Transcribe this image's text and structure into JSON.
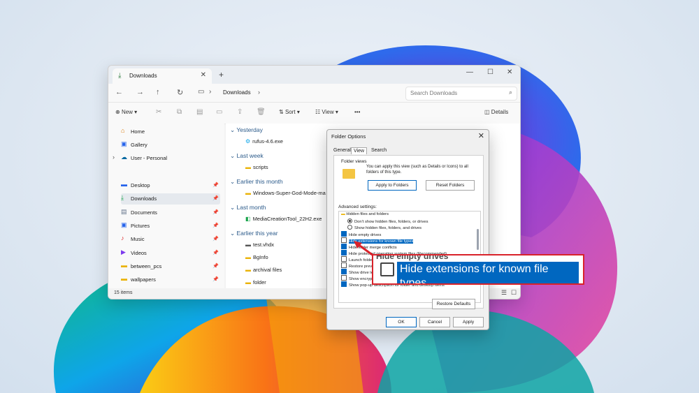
{
  "explorer": {
    "tab_title": "Downloads",
    "breadcrumb": "Downloads",
    "search_placeholder": "Search Downloads",
    "toolbar": {
      "new": "New",
      "sort": "Sort",
      "view": "View",
      "more": "•••",
      "details": "Details"
    },
    "sidebar": [
      {
        "label": "Home",
        "icon": "home-icon",
        "pinned": false
      },
      {
        "label": "Gallery",
        "icon": "gallery-icon",
        "pinned": false
      },
      {
        "label": "User - Personal",
        "icon": "cloud-icon",
        "pinned": false
      },
      {
        "label": "Desktop",
        "icon": "desktop-icon",
        "pinned": true
      },
      {
        "label": "Downloads",
        "icon": "download-icon",
        "pinned": true,
        "selected": true
      },
      {
        "label": "Documents",
        "icon": "documents-icon",
        "pinned": true
      },
      {
        "label": "Pictures",
        "icon": "pictures-icon",
        "pinned": true
      },
      {
        "label": "Music",
        "icon": "music-icon",
        "pinned": true
      },
      {
        "label": "Videos",
        "icon": "videos-icon",
        "pinned": true
      },
      {
        "label": "between_pcs",
        "icon": "folder-icon",
        "pinned": true
      },
      {
        "label": "wallpapers",
        "icon": "folder-icon",
        "pinned": true
      }
    ],
    "groups": [
      {
        "label": "Yesterday",
        "files": [
          "rufus-4.6.exe"
        ]
      },
      {
        "label": "Last week",
        "files": [
          "scripts"
        ]
      },
      {
        "label": "Earlier this month",
        "files": [
          "Windows-Super-God-Mode-ma"
        ]
      },
      {
        "label": "Last month",
        "files": [
          "MediaCreationTool_22H2.exe"
        ]
      },
      {
        "label": "Earlier this year",
        "files": [
          "test.vhdx",
          "BgInfo",
          "archival files",
          "folder"
        ]
      }
    ],
    "status": "15 items"
  },
  "dialog": {
    "title": "Folder Options",
    "tabs": [
      "General",
      "View",
      "Search"
    ],
    "folder_views_head": "Folder views",
    "folder_views_text": "You can apply this view (such as Details or Icons) to all folders of this type.",
    "apply_to_folders": "Apply to Folders",
    "reset_folders": "Reset Folders",
    "advanced_head": "Advanced settings:",
    "options": [
      {
        "type": "folder",
        "label": "Hidden files and folders"
      },
      {
        "type": "radio",
        "label": "Don't show hidden files, folders, or drives",
        "checked": true
      },
      {
        "type": "radio",
        "label": "Show hidden files, folders, and drives",
        "checked": false
      },
      {
        "type": "check",
        "label": "Hide empty drives",
        "checked": true
      },
      {
        "type": "check",
        "label": "Hide extensions for known file types",
        "checked": false,
        "highlighted": true
      },
      {
        "type": "check",
        "label": "Hide folder merge conflicts",
        "checked": true
      },
      {
        "type": "check",
        "label": "Hide protected operating system files (Recommended)",
        "checked": true
      },
      {
        "type": "check",
        "label": "Launch folder windows in a separate process",
        "checked": false
      },
      {
        "type": "check",
        "label": "Restore previous folder windows at logon",
        "checked": false
      },
      {
        "type": "check",
        "label": "Show drive letters",
        "checked": true
      },
      {
        "type": "check",
        "label": "Show encrypted or compressed NTFS files in color",
        "checked": false
      },
      {
        "type": "check",
        "label": "Show pop-up description for folder and desktop items",
        "checked": true
      }
    ],
    "restore_defaults": "Restore Defaults",
    "ok": "OK",
    "cancel": "Cancel",
    "apply": "Apply"
  },
  "callout": {
    "label": "Hide extensions for known file types",
    "behind_text": "Hide empty drives"
  },
  "colors": {
    "accent": "#0067c0",
    "callout_border": "#d9222a",
    "group_header": "#2b5a8a"
  }
}
